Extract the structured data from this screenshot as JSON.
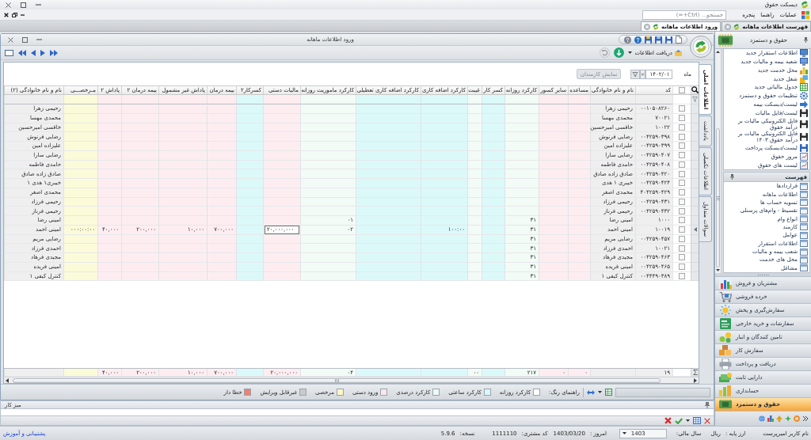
{
  "app": {
    "title": "دیسکت حقوق"
  },
  "menu": {
    "items": [
      "عملیات",
      "راهنما",
      "پنجره"
    ],
    "search_placeholder": "جستجو... (Ctrl+=)"
  },
  "doc_tabs": [
    {
      "label": "فهرست اطلاعات ماهانه",
      "selected": false
    },
    {
      "label": "ورود اطلاعات ماهانه",
      "selected": true
    }
  ],
  "window": {
    "title": "ورود اطلاعات ماهانه",
    "fetch_label": "دریافت اطلاعات"
  },
  "filter": {
    "month_label": "ماه",
    "month_value": "۱۴۰۲/۰۱",
    "show_button": "نمایش کارمندان",
    "show_disabled": true
  },
  "side_tabs": [
    {
      "label": "اطلاعات اصلی",
      "selected": true
    },
    {
      "label": "یادداشت",
      "selected": false
    },
    {
      "label": "اطلاعات تکمیلی",
      "selected": false
    },
    {
      "label": "سوالات متداول",
      "selected": false
    }
  ],
  "grid": {
    "all_checked": false,
    "columns": [
      {
        "label": "کد",
        "color": "#efefef"
      },
      {
        "label": "نام و نام خانوادگی",
        "color": "#efefef"
      },
      {
        "label": "مساعده",
        "color": "#fdedf1"
      },
      {
        "label": "سایر کسور",
        "color": "#fdedf1"
      },
      {
        "label": "کارکرد روزانه",
        "color": "#f2fbf5"
      },
      {
        "label": "کسر کار",
        "color": "#dcf9fa"
      },
      {
        "label": "غیبت",
        "color": "#f2fbf5"
      },
      {
        "label": "کارکرد اضافه کاری",
        "color": "#dcf9fa"
      },
      {
        "label": "کارکرد اضافه کاری تعطیلی",
        "color": "#dcf9fa"
      },
      {
        "label": "کارکرد ماموریت روزانه",
        "color": "#f2fbf5"
      },
      {
        "label": "مالیات دستی",
        "color": "#fdedf1"
      },
      {
        "label": "کسرکار۲",
        "color": "#dcf9fa"
      },
      {
        "label": "بیمه درمان",
        "color": "#fdedf1"
      },
      {
        "label": "پاداش غیر مشمول",
        "color": "#fdedf1"
      },
      {
        "label": "بیمه درمان ۲",
        "color": "#fdedf1"
      },
      {
        "label": "پاداش ۲",
        "color": "#fdedf1"
      },
      {
        "label": "مـرخصـــی",
        "color": "#fcfbd9"
      },
      {
        "label": "نام و نام خانوادگی (۲)",
        "color": "#efefef"
      }
    ],
    "rows": [
      {
        "selected": false,
        "checked": false,
        "cells": [
          "۰۰۱۰۵۰۸۲۶۰",
          "رحیمی زهرا",
          null,
          null,
          null,
          null,
          null,
          null,
          null,
          null,
          null,
          null,
          null,
          null,
          null,
          null,
          null,
          "رحیمی زهرا"
        ]
      },
      {
        "selected": false,
        "checked": false,
        "cells": [
          "۷۰۰۲۱",
          "محمدی مهسا",
          null,
          null,
          null,
          null,
          null,
          null,
          null,
          null,
          null,
          null,
          null,
          null,
          null,
          null,
          null,
          "محمدی مهسا"
        ]
      },
      {
        "selected": false,
        "checked": false,
        "cells": [
          "۱۰۰۲۲",
          "خاقسی امیرحسین",
          null,
          null,
          null,
          null,
          null,
          null,
          null,
          null,
          null,
          null,
          null,
          null,
          null,
          null,
          null,
          "خاقسی امیرحسین"
        ]
      },
      {
        "selected": false,
        "checked": false,
        "cells": [
          "۰۰۴۲۵۹۰۳۹۸",
          "رضایی فرنوش",
          null,
          null,
          null,
          null,
          null,
          null,
          null,
          null,
          null,
          null,
          null,
          null,
          null,
          null,
          null,
          "رضایی فرنوش"
        ]
      },
      {
        "selected": false,
        "checked": false,
        "cells": [
          "۰۰۴۲۵۹۰۳۹۹",
          "علیزاده امین",
          null,
          null,
          null,
          null,
          null,
          null,
          null,
          null,
          null,
          null,
          null,
          null,
          null,
          null,
          null,
          "علیزاده امین"
        ]
      },
      {
        "selected": false,
        "checked": false,
        "cells": [
          "۰۰۴۲۵۹۰۴۰۷",
          "رضایی سارا",
          null,
          null,
          null,
          null,
          null,
          null,
          null,
          null,
          null,
          null,
          null,
          null,
          null,
          null,
          null,
          "رضایی سارا"
        ]
      },
      {
        "selected": false,
        "checked": false,
        "cells": [
          "۰۰۴۲۵۹۰۴۰۸",
          "حامدی فاطمه",
          null,
          null,
          null,
          null,
          null,
          null,
          null,
          null,
          null,
          null,
          null,
          null,
          null,
          null,
          null,
          "حامدی فاطمه"
        ]
      },
      {
        "selected": false,
        "checked": false,
        "cells": [
          "۰۰۴۲۵۹۰۴۲۰",
          "صادق زاده صادق",
          null,
          null,
          null,
          null,
          null,
          null,
          null,
          null,
          null,
          null,
          null,
          null,
          null,
          null,
          null,
          "صادق زاده صادق"
        ]
      },
      {
        "selected": false,
        "checked": false,
        "cells": [
          "۰۰۴۲۵۹۰۴۲۴",
          "خیبری ۱ هدی",
          null,
          null,
          null,
          null,
          null,
          null,
          null,
          null,
          null,
          null,
          null,
          null,
          null,
          null,
          null,
          "خیبری۱ هدی ۱"
        ]
      },
      {
        "selected": false,
        "checked": false,
        "cells": [
          "۴۰۴۲۵۹۰۴۲۹",
          "محمدی اصغر",
          null,
          null,
          null,
          null,
          null,
          null,
          null,
          null,
          null,
          null,
          null,
          null,
          null,
          null,
          null,
          "محمدی اصغر"
        ]
      },
      {
        "selected": false,
        "checked": false,
        "cells": [
          "۰۰۴۲۵۹۰۴۳۱",
          "رحیمی فرزاد",
          null,
          null,
          null,
          null,
          null,
          null,
          null,
          null,
          null,
          null,
          null,
          null,
          null,
          null,
          null,
          "رحیمی فرزاد"
        ]
      },
      {
        "selected": false,
        "checked": false,
        "cells": [
          "۰۰۴۲۵۹۰۴۳۲",
          "رحیمی فرناز",
          null,
          null,
          null,
          null,
          null,
          null,
          null,
          null,
          null,
          null,
          null,
          null,
          null,
          null,
          null,
          "رحیمی فرناز"
        ]
      },
      {
        "selected": false,
        "checked": false,
        "cells": [
          "۱۰۰۰",
          "امینی رضا",
          null,
          null,
          "۳۱",
          null,
          null,
          null,
          null,
          "۰۱",
          null,
          null,
          null,
          null,
          null,
          null,
          null,
          "امینی رضا"
        ]
      },
      {
        "selected": true,
        "checked": false,
        "cells": [
          "۱۰۰۱۹",
          "امینی احمد",
          null,
          null,
          "۳۱",
          null,
          null,
          "۱۰۰:۰۰",
          null,
          "۰۲",
          {
            "value": "۲۰,۰۰۰,۰۰۰",
            "editing": true
          },
          null,
          "۷۰۰,۰۰۰",
          "۱۰,۰۰۰",
          "۲۰۰,۰۰۰",
          "۴۰,۰۰۰",
          "۰۰۰:۰۰:۰۰",
          "امینی احمد"
        ]
      },
      {
        "selected": false,
        "checked": false,
        "cells": [
          "۰۰۴۲۵۹۰۴۵۷",
          "رضایی مریم",
          null,
          null,
          "۳۱",
          null,
          null,
          null,
          null,
          null,
          null,
          null,
          null,
          null,
          null,
          null,
          null,
          "رضایی مریم"
        ]
      },
      {
        "selected": false,
        "checked": false,
        "cells": [
          "۱۰۰۲۱",
          "احمدی فرزاد",
          null,
          null,
          "۳۱",
          null,
          null,
          null,
          null,
          null,
          null,
          null,
          null,
          null,
          null,
          null,
          null,
          "احمدی فرزاد"
        ]
      },
      {
        "selected": false,
        "checked": false,
        "cells": [
          "۰۰۴۲۵۹۰۴۶۳",
          "مجیدی فرهاد",
          null,
          null,
          "۳۱",
          null,
          null,
          null,
          null,
          null,
          null,
          null,
          null,
          null,
          null,
          null,
          null,
          "مجیدی فرهاد"
        ]
      },
      {
        "selected": false,
        "checked": false,
        "cells": [
          "۰۰۴۲۵۹۰۴۶۵",
          "امینی فریده",
          null,
          null,
          "۳۱",
          null,
          null,
          null,
          null,
          null,
          null,
          null,
          null,
          null,
          null,
          null,
          null,
          "امینی فریده"
        ]
      },
      {
        "selected": false,
        "checked": false,
        "cells": [
          "۰۰۴۴۴۹۰۳۸۹",
          "کنترل کیفی ۱",
          null,
          null,
          "۳۱",
          null,
          null,
          null,
          null,
          null,
          null,
          null,
          null,
          null,
          null,
          null,
          null,
          "کنترل کیفی ۱"
        ]
      }
    ],
    "footer": {
      "cells": [
        "۱۹",
        null,
        "۰",
        "۰",
        "۲۱۷",
        null,
        "۰۰",
        null,
        null,
        "۰۴",
        "۲۰,۰۰۰,۰۰۰",
        null,
        "۷۰۰,۰۰۰",
        "۱۰,۰۰۰",
        "۲۰۰,۰۰۰",
        "۴۰,۰۰۰",
        null,
        null
      ]
    }
  },
  "legend": {
    "title": "راهنمای رنگ:",
    "items": [
      {
        "label": "کارکرد روزانه",
        "color": "#ffffff"
      },
      {
        "label": "کارکرد ساعتی",
        "color": "#d8f8fa"
      },
      {
        "label": "کارکرد درصدی",
        "color": "#eefaf3"
      },
      {
        "label": "ورود دستی",
        "color": "#fde6ec"
      },
      {
        "label": "مرخصی",
        "color": "#fbf6c6"
      },
      {
        "label": "غیرقابل ویرایش",
        "color": "#c9c9c9"
      },
      {
        "label": "خطا دار",
        "color": "#f08070"
      }
    ]
  },
  "desk": {
    "title": "میز کار"
  },
  "sidebar": {
    "title": "حقوق و دستمزد",
    "tasks": [
      "اطلاعات استقرار جدید",
      "شعبه بیمه و مالیات جدید",
      "محل خدمت جدید",
      "شغل جدید",
      "جدول مالیاتی جدید",
      "تنظیمات حقوق و دستمزد",
      "لیست/دیسکت بیمه",
      "لیست/فایل مالیات",
      "فایل الکترونیکی مالیات بر درآمد حقوق",
      "فایل الکترونیکی مالیات بر درآمد حقوق ۱۴۰۳",
      "لیست/دیسکت پرداخت",
      "مرور حقوق",
      "لیست های حقوق"
    ],
    "list_title": "فهرست",
    "list": [
      "قراردادها",
      "اطلاعات ماهانه",
      "تسویه حساب ها",
      "تقسیط - وام‌های پرسنلی",
      "انواع وام",
      "کارمند",
      "عوامل",
      "اطلاعات استقرار",
      "شعب بیمه و مالیات",
      "محل های خدمت",
      "مشاغل"
    ],
    "modules": [
      {
        "label": "مشتریان و فروش",
        "selected": false
      },
      {
        "label": "خرده فروشی",
        "selected": false
      },
      {
        "label": "سفارش‌گیری و پخش",
        "selected": false
      },
      {
        "label": "سفارشات و خرید خارجی",
        "selected": false
      },
      {
        "label": "تامین کنندگان و انبار",
        "selected": false
      },
      {
        "label": "سفارش کار",
        "selected": false
      },
      {
        "label": "دریافت و پرداخت",
        "selected": false
      },
      {
        "label": "دارایی ثابت",
        "selected": false
      },
      {
        "label": "حسابداری",
        "selected": false
      },
      {
        "label": "حقوق و دستمزد",
        "selected": true
      }
    ]
  },
  "status_bar": {
    "user": "نام کاربر امیرپرست",
    "currency_label": "ارز پایه :",
    "currency": "ریال",
    "year_label": "سال مالی:",
    "year": "1403",
    "today_label": "امروز :",
    "today": "1403/03/20",
    "customer_label": "کد مشتری:",
    "customer": "1111110",
    "version_label": "نسخه:",
    "version": "5.9.6",
    "support_link": "پشتیبانی و آموزش"
  }
}
